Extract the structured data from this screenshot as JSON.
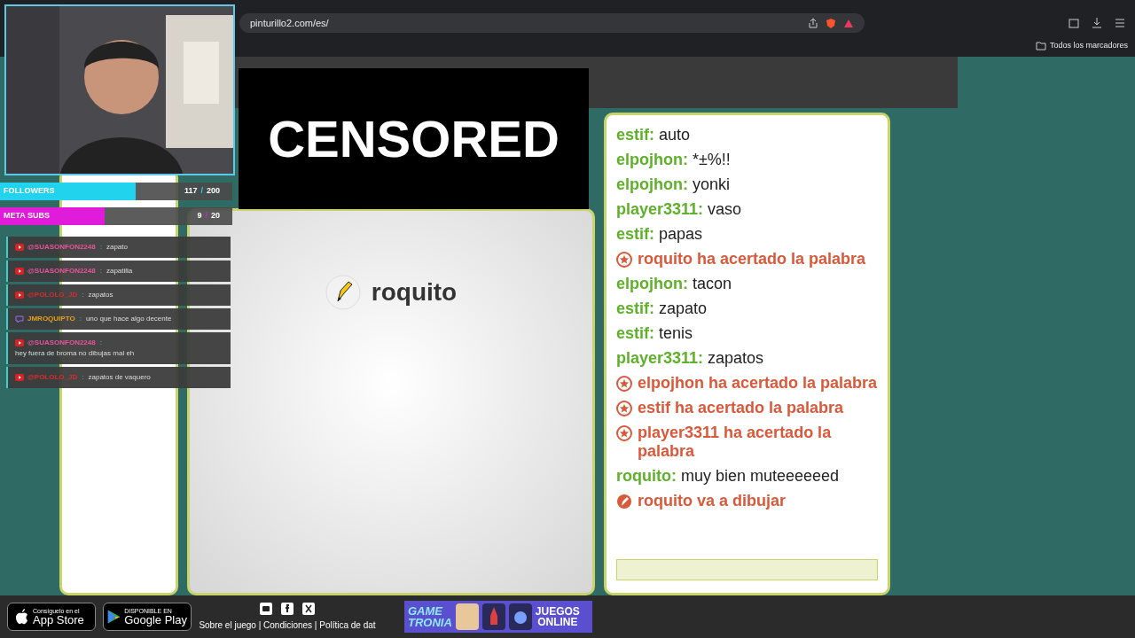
{
  "browser": {
    "url": "pinturillo2.com/es/",
    "bookmarks_label": "Todos los marcadores"
  },
  "censor": {
    "text": "CENSORED"
  },
  "drawer": {
    "name": "roquito"
  },
  "chat": [
    {
      "kind": "message",
      "user": "estif:",
      "text": "auto"
    },
    {
      "kind": "message",
      "user": "elpojhon:",
      "text": "*±%!!"
    },
    {
      "kind": "message",
      "user": "elpojhon:",
      "text": "yonki"
    },
    {
      "kind": "message",
      "user": "player3311:",
      "text": "vaso"
    },
    {
      "kind": "message",
      "user": "estif:",
      "text": "papas"
    },
    {
      "kind": "system",
      "text": "roquito ha acertado la palabra"
    },
    {
      "kind": "message",
      "user": "elpojhon:",
      "text": "tacon"
    },
    {
      "kind": "message",
      "user": "estif:",
      "text": "zapato"
    },
    {
      "kind": "message",
      "user": "estif:",
      "text": "tenis"
    },
    {
      "kind": "message",
      "user": "player3311:",
      "text": "zapatos"
    },
    {
      "kind": "system",
      "text": "elpojhon ha acertado la palabra"
    },
    {
      "kind": "system",
      "text": "estif ha acertado la palabra"
    },
    {
      "kind": "system",
      "text": "player3311 ha acertado la palabra"
    },
    {
      "kind": "message",
      "user": "roquito:",
      "text": "muy bien muteeeeeed"
    },
    {
      "kind": "drawing",
      "text": "roquito va a dibujar"
    }
  ],
  "overlay": {
    "goals": [
      {
        "label": "FOLLOWERS",
        "current": "117",
        "slash": "/",
        "target": "200",
        "level": 0.585,
        "color": "#22d3ee"
      },
      {
        "label": "META SUBS",
        "current": "9",
        "slash": "/",
        "target": "20",
        "level": 0.45,
        "color": "#e01bd9"
      }
    ],
    "stream_chat": [
      {
        "kind": "youtube",
        "user": "@SUASONFON2248",
        "separator": ":",
        "text": "zapato",
        "color": "#e8559a"
      },
      {
        "kind": "youtube",
        "user": "@SUASONFON2248",
        "separator": ":",
        "text": "zapatilla",
        "color": "#e8559a"
      },
      {
        "kind": "youtube",
        "user": "@POLOLO_JD",
        "separator": ":",
        "text": "zapatos",
        "color": "#d62d2d"
      },
      {
        "kind": "twitch",
        "user": "JMROQUIPTO",
        "separator": ":",
        "text": "uno que hace algo decente",
        "color": "#e6a019"
      },
      {
        "kind": "youtube",
        "user": "@SUASONFON2248",
        "separator": ":",
        "text": "hey fuera de broma no dibujas mal eh",
        "color": "#e8559a"
      },
      {
        "kind": "youtube",
        "user": "@POLOLO_JD",
        "separator": ":",
        "text": "zapatos de vaquero",
        "color": "#d62d2d"
      }
    ]
  },
  "footer": {
    "app_store": {
      "small": "Consíguelo en el",
      "big": "App Store"
    },
    "google_play": {
      "small": "DISPONIBLE EN",
      "big": "Google Play"
    },
    "links": "Sobre el juego | Condiciones | Política de dat",
    "promo": {
      "logo_top": "GAME",
      "logo_bottom": "TRONIA",
      "text_top": "JUEGOS",
      "text_bottom": "ONLINE"
    }
  }
}
